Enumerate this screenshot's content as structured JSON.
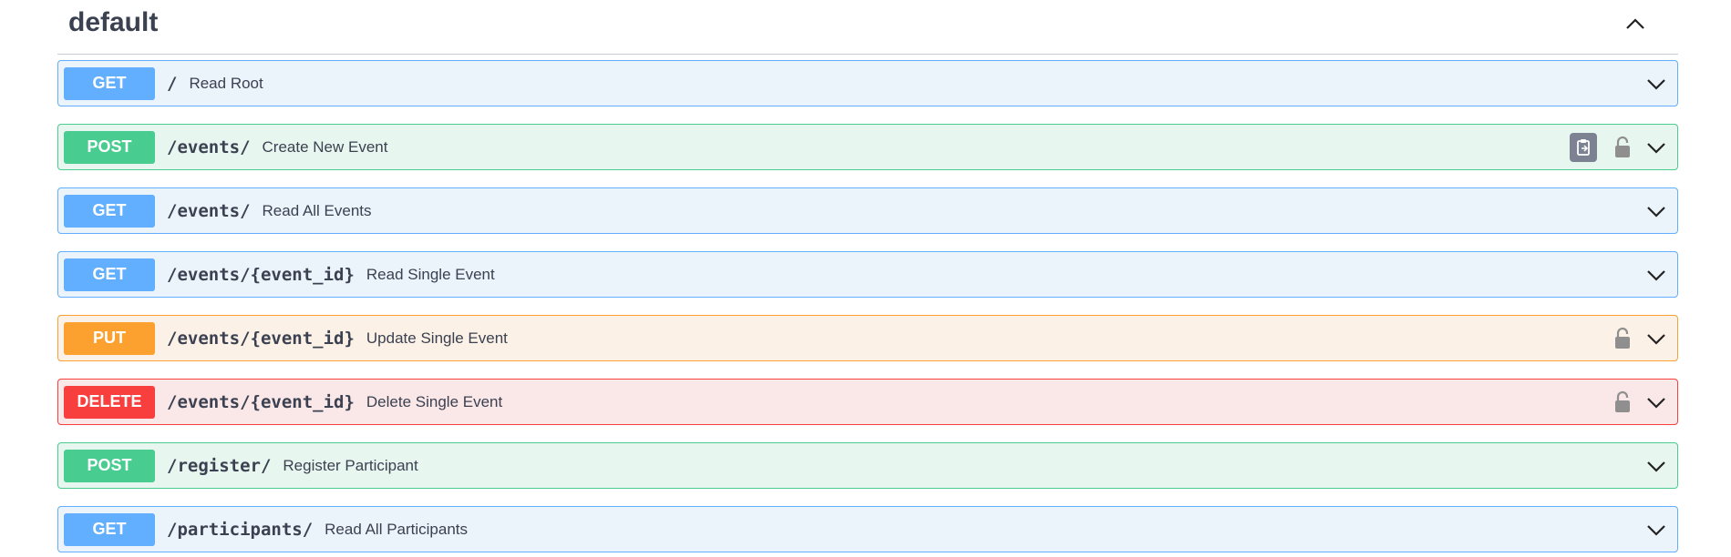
{
  "tag": {
    "title": "default",
    "toggle_icon": "chevron-up-icon"
  },
  "operations": [
    {
      "method": "GET",
      "path": "/",
      "summary": "Read Root",
      "has_copy": false,
      "has_lock": false
    },
    {
      "method": "POST",
      "path": "/events/",
      "summary": "Create New Event",
      "has_copy": true,
      "has_lock": true
    },
    {
      "method": "GET",
      "path": "/events/",
      "summary": "Read All Events",
      "has_copy": false,
      "has_lock": false
    },
    {
      "method": "GET",
      "path": "/events/{event_id}",
      "summary": "Read Single Event",
      "has_copy": false,
      "has_lock": false
    },
    {
      "method": "PUT",
      "path": "/events/{event_id}",
      "summary": "Update Single Event",
      "has_copy": false,
      "has_lock": true
    },
    {
      "method": "DELETE",
      "path": "/events/{event_id}",
      "summary": "Delete Single Event",
      "has_copy": false,
      "has_lock": true
    },
    {
      "method": "POST",
      "path": "/register/",
      "summary": "Register Participant",
      "has_copy": false,
      "has_lock": false
    },
    {
      "method": "GET",
      "path": "/participants/",
      "summary": "Read All Participants",
      "has_copy": false,
      "has_lock": false
    }
  ],
  "colors": {
    "get": "#61affe",
    "post": "#49cc90",
    "put": "#fca130",
    "delete": "#f93e3e",
    "text": "#3b4151"
  }
}
